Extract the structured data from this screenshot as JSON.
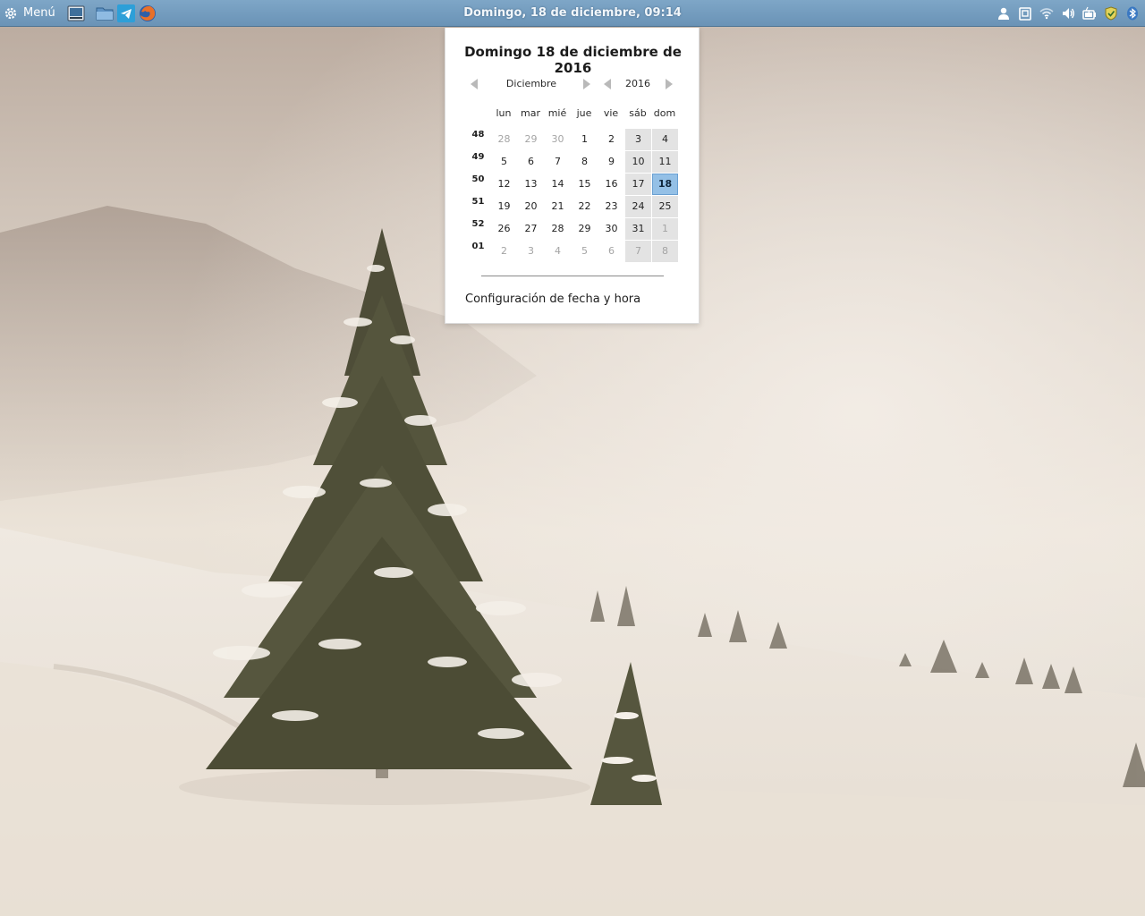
{
  "panel": {
    "menu_label": "Menú",
    "clock_text": "Domingo, 18 de diciembre, 09:14",
    "launchers": [
      "desktop-icon",
      "file-manager-icon",
      "telegram-icon",
      "firefox-icon"
    ],
    "tray_icons": [
      "user-icon",
      "clipboard-icon",
      "wifi-icon",
      "volume-icon",
      "battery-icon",
      "shield-icon",
      "bluetooth-icon"
    ]
  },
  "calendar": {
    "title": "Domingo 18 de diciembre de 2016",
    "month": "Diciembre",
    "year": "2016",
    "weekdays": [
      "lun",
      "mar",
      "mié",
      "jue",
      "vie",
      "sáb",
      "dom"
    ],
    "weeks": [
      {
        "num": "48",
        "days": [
          "28",
          "29",
          "30",
          "1",
          "2",
          "3",
          "4"
        ]
      },
      {
        "num": "49",
        "days": [
          "5",
          "6",
          "7",
          "8",
          "9",
          "10",
          "11"
        ]
      },
      {
        "num": "50",
        "days": [
          "12",
          "13",
          "14",
          "15",
          "16",
          "17",
          "18"
        ]
      },
      {
        "num": "51",
        "days": [
          "19",
          "20",
          "21",
          "22",
          "23",
          "24",
          "25"
        ]
      },
      {
        "num": "52",
        "days": [
          "26",
          "27",
          "28",
          "29",
          "30",
          "31",
          "1"
        ]
      },
      {
        "num": "01",
        "days": [
          "2",
          "3",
          "4",
          "5",
          "6",
          "7",
          "8"
        ]
      }
    ],
    "today": "18",
    "settings_label": "Configuración de fecha y hora"
  },
  "colors": {
    "panel": "#6a93b6",
    "today_highlight": "#94c0e6",
    "weekend_bg": "#e3e3e3"
  }
}
